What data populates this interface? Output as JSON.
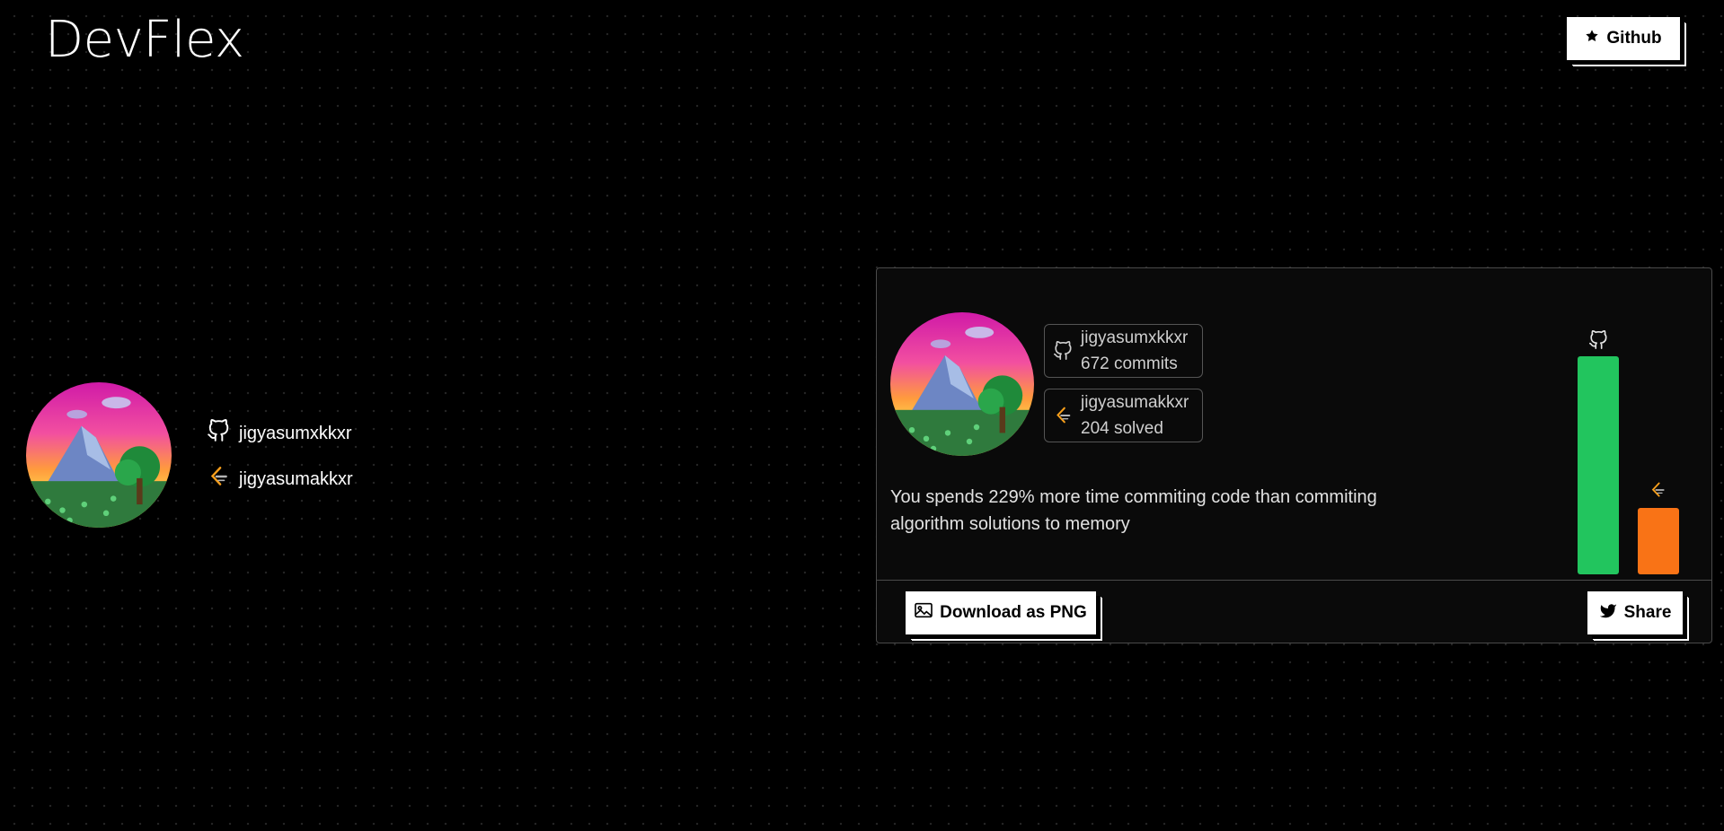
{
  "header": {
    "app_title": "DevFlex",
    "github_button_label": "Github"
  },
  "profile": {
    "github_username": "jigyasumxkkxr",
    "leetcode_username": "jigyasumakkxr"
  },
  "card": {
    "github_stat": {
      "username": "jigyasumxkkxr",
      "value": "672 commits"
    },
    "leetcode_stat": {
      "username": "jigyasumakkxr",
      "value": "204 solved"
    },
    "summary": "You spends 229% more time commiting code than commiting algorithm solutions to memory",
    "download_button_label": "Download as PNG",
    "share_button_label": "Share"
  },
  "chart_data": {
    "type": "bar",
    "categories": [
      "github-icon",
      "leetcode-icon"
    ],
    "values": [
      672,
      204
    ],
    "colors": [
      "#22c55e",
      "#f97316"
    ]
  },
  "icons": {
    "star": "star-icon",
    "github": "github-icon",
    "leetcode": "leetcode-icon",
    "image": "image-icon",
    "twitter": "twitter-icon"
  }
}
